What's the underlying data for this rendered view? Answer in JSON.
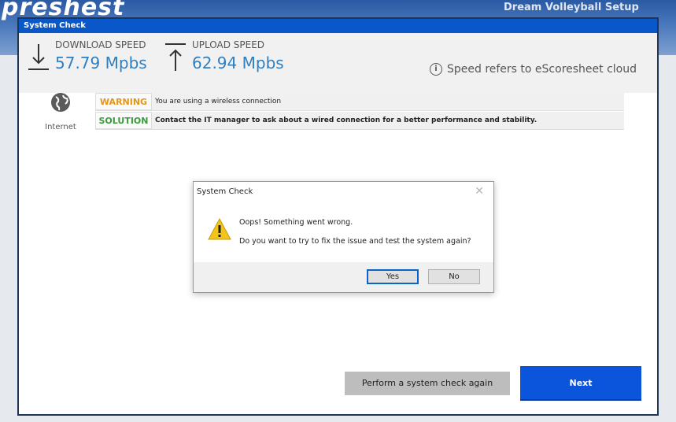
{
  "background": {
    "logo_text": "preshest",
    "right_text": "Dream Volleyball Setup"
  },
  "window": {
    "title": "System Check"
  },
  "speed": {
    "download_label": "DOWNLOAD SPEED",
    "download_value": "57.79 Mpbs",
    "upload_label": "UPLOAD SPEED",
    "upload_value": "62.94 Mpbs",
    "note": "Speed refers to eScoresheet cloud"
  },
  "internet": {
    "label": "Internet"
  },
  "messages": [
    {
      "tag": "WARNING",
      "text": "You are using a wireless connection"
    },
    {
      "tag": "SOLUTION",
      "text": "Contact the IT manager to ask about a wired connection for a better performance and stability."
    }
  ],
  "dialog": {
    "title": "System Check",
    "line1": "Oops! Something went wrong.",
    "line2": "Do you want to try to fix the issue and test the system again?",
    "yes_label": "Yes",
    "no_label": "No"
  },
  "buttons": {
    "again_label": "Perform a system check again",
    "next_label": "Next"
  },
  "colors": {
    "title_bar": "#0a57c9",
    "speed_value": "#2f7fc1",
    "warning": "#e69515",
    "solution": "#3a9b3a",
    "next_button": "#0b55dc"
  }
}
